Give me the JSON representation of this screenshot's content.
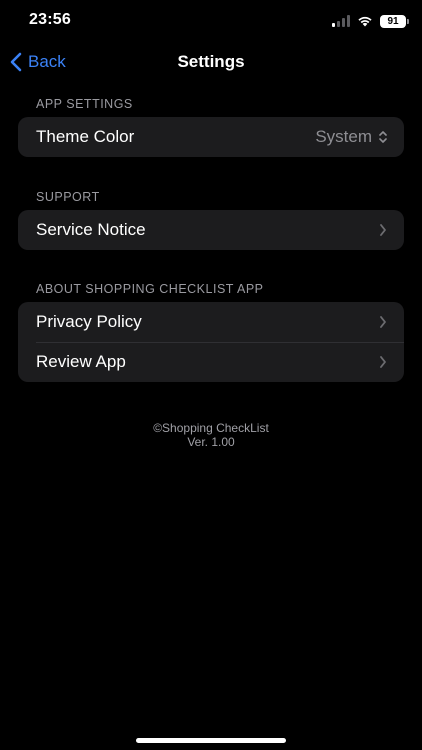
{
  "status_bar": {
    "time": "23:56",
    "battery": "91",
    "icons": [
      "cellular-signal-icon",
      "wifi-icon",
      "battery-icon"
    ]
  },
  "nav": {
    "back_label": "Back",
    "title": "Settings",
    "back_icon": "chevron-left-icon",
    "accent_color": "#3b82f6"
  },
  "sections": {
    "app_settings": {
      "header": "APP SETTINGS",
      "theme_color": {
        "label": "Theme Color",
        "value": "System",
        "icon": "up-down-chevron-icon"
      }
    },
    "support": {
      "header": "SUPPORT",
      "service_notice": {
        "label": "Service Notice",
        "icon": "chevron-right-icon"
      }
    },
    "about": {
      "header": "ABOUT SHOPPING CHECKLIST APP",
      "privacy_policy": {
        "label": "Privacy Policy",
        "icon": "chevron-right-icon"
      },
      "review_app": {
        "label": "Review App",
        "icon": "chevron-right-icon"
      }
    }
  },
  "footer": {
    "copyright": "©Shopping CheckList",
    "version": "Ver. 1.00"
  },
  "colors": {
    "background": "#000000",
    "group_background": "#1c1c1e",
    "secondary_text": "#8e8e93"
  }
}
